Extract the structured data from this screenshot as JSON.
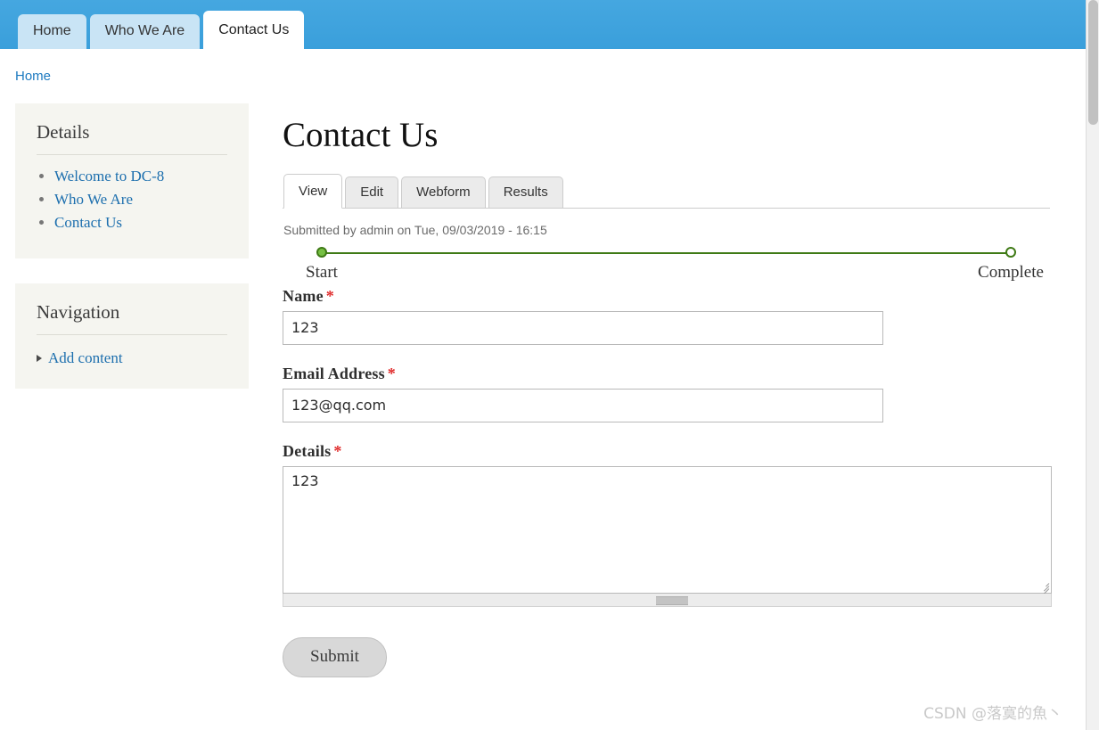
{
  "site_header": {
    "tabs": [
      {
        "label": "Home",
        "active": false
      },
      {
        "label": "Who We Are",
        "active": false
      },
      {
        "label": "Contact Us",
        "active": true
      }
    ]
  },
  "breadcrumb": {
    "home_label": "Home"
  },
  "sidebar": {
    "blocks": [
      {
        "title": "Details",
        "type": "links",
        "items": [
          {
            "label": "Welcome to DC-8"
          },
          {
            "label": "Who We Are"
          },
          {
            "label": "Contact Us"
          }
        ]
      },
      {
        "title": "Navigation",
        "type": "menu",
        "items": [
          {
            "label": "Add content",
            "icon": "caret-right-icon"
          }
        ]
      }
    ]
  },
  "main": {
    "page_title": "Contact Us",
    "local_tabs": [
      {
        "label": "View",
        "active": true
      },
      {
        "label": "Edit",
        "active": false
      },
      {
        "label": "Webform",
        "active": false
      },
      {
        "label": "Results",
        "active": false
      }
    ],
    "submitted_info": "Submitted by admin on Tue, 09/03/2019 - 16:15",
    "progress": {
      "steps": [
        {
          "label": "Start",
          "state": "done"
        },
        {
          "label": "Complete",
          "state": "pending"
        }
      ],
      "line_color": "#3f7a16",
      "done_color": "#76c043"
    },
    "form": {
      "required_marker": "*",
      "fields": [
        {
          "label": "Name",
          "required": true,
          "value": "123",
          "placeholder": "",
          "type": "text"
        },
        {
          "label": "Email Address",
          "required": true,
          "value": "123@qq.com",
          "placeholder": "",
          "type": "text"
        },
        {
          "label": "Details",
          "required": true,
          "value": "123",
          "placeholder": "",
          "type": "textarea"
        }
      ],
      "submit_label": "Submit"
    }
  },
  "watermark": {
    "text": "CSDN @落寞的魚丶"
  },
  "colors": {
    "header_blue": "#3a9fdb",
    "tab_inactive_blue": "#c9e4f5",
    "link_blue": "#1d6fae",
    "sidebar_bg": "#f5f5f0",
    "required_red": "#e02b2b",
    "progress_green": "#3f7a16"
  }
}
